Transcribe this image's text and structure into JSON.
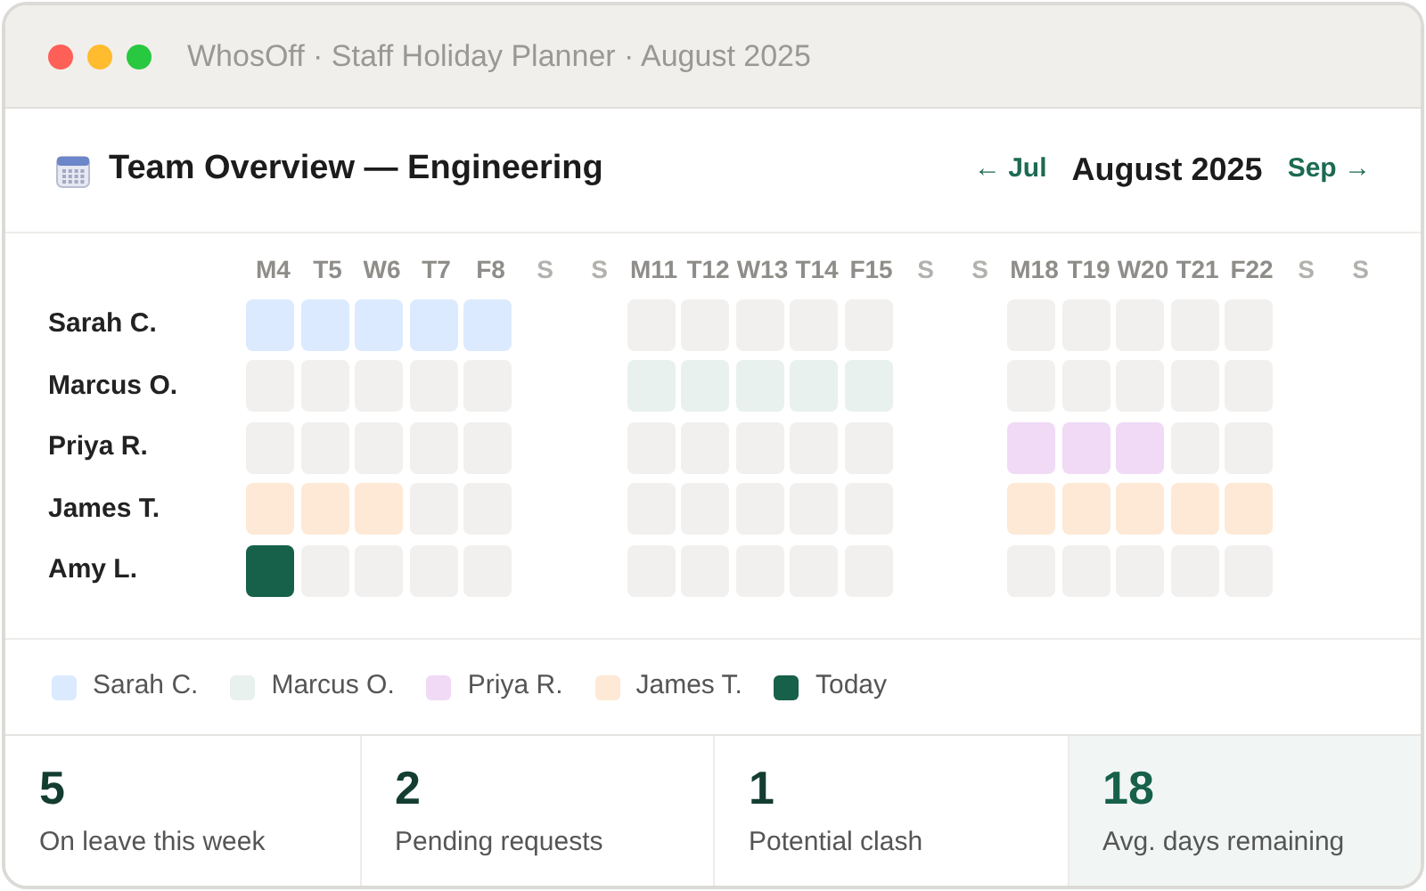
{
  "window": {
    "title": "WhosOff · Staff Holiday Planner · August 2025"
  },
  "header": {
    "title": "Team Overview — Engineering",
    "prev": "← Jul",
    "month": "August 2025",
    "next": "Sep →"
  },
  "days": [
    {
      "label": "M4",
      "weekend": false
    },
    {
      "label": "T5",
      "weekend": false
    },
    {
      "label": "W6",
      "weekend": false
    },
    {
      "label": "T7",
      "weekend": false
    },
    {
      "label": "F8",
      "weekend": false
    },
    {
      "label": "S",
      "weekend": true
    },
    {
      "label": "S",
      "weekend": true
    },
    {
      "label": "M11",
      "weekend": false
    },
    {
      "label": "T12",
      "weekend": false
    },
    {
      "label": "W13",
      "weekend": false
    },
    {
      "label": "T14",
      "weekend": false
    },
    {
      "label": "F15",
      "weekend": false
    },
    {
      "label": "S",
      "weekend": true
    },
    {
      "label": "S",
      "weekend": true
    },
    {
      "label": "M18",
      "weekend": false
    },
    {
      "label": "T19",
      "weekend": false
    },
    {
      "label": "W20",
      "weekend": false
    },
    {
      "label": "T21",
      "weekend": false
    },
    {
      "label": "F22",
      "weekend": false
    },
    {
      "label": "S",
      "weekend": true
    },
    {
      "label": "S",
      "weekend": true
    }
  ],
  "rows": [
    {
      "name": "Sarah C.",
      "cells": [
        {
          "kind": "leave"
        },
        {
          "kind": "leave"
        },
        {
          "kind": "leave"
        },
        {
          "kind": "leave"
        },
        {
          "kind": "leave"
        },
        {
          "kind": "free"
        },
        {
          "kind": "free"
        },
        {
          "kind": "free"
        },
        {
          "kind": "free"
        },
        {
          "kind": "free"
        },
        {
          "kind": "free"
        },
        {
          "kind": "free"
        },
        {
          "kind": "free"
        },
        {
          "kind": "free"
        },
        {
          "kind": "free"
        }
      ]
    },
    {
      "name": "Marcus O.",
      "cells": [
        {
          "kind": "free"
        },
        {
          "kind": "free"
        },
        {
          "kind": "free"
        },
        {
          "kind": "free"
        },
        {
          "kind": "free"
        },
        {
          "kind": "leave"
        },
        {
          "kind": "leave"
        },
        {
          "kind": "leave"
        },
        {
          "kind": "leave"
        },
        {
          "kind": "leave"
        },
        {
          "kind": "free"
        },
        {
          "kind": "free"
        },
        {
          "kind": "free"
        },
        {
          "kind": "free"
        },
        {
          "kind": "free"
        }
      ]
    },
    {
      "name": "Priya R.",
      "cells": [
        {
          "kind": "free"
        },
        {
          "kind": "free"
        },
        {
          "kind": "free"
        },
        {
          "kind": "free"
        },
        {
          "kind": "free"
        },
        {
          "kind": "free"
        },
        {
          "kind": "free"
        },
        {
          "kind": "free"
        },
        {
          "kind": "free"
        },
        {
          "kind": "free"
        },
        {
          "kind": "leave"
        },
        {
          "kind": "leave"
        },
        {
          "kind": "leave"
        },
        {
          "kind": "free"
        },
        {
          "kind": "free"
        }
      ]
    },
    {
      "name": "James T.",
      "cells": [
        {
          "kind": "leave"
        },
        {
          "kind": "leave"
        },
        {
          "kind": "leave"
        },
        {
          "kind": "free"
        },
        {
          "kind": "free"
        },
        {
          "kind": "free"
        },
        {
          "kind": "free"
        },
        {
          "kind": "free"
        },
        {
          "kind": "free"
        },
        {
          "kind": "free"
        },
        {
          "kind": "leave"
        },
        {
          "kind": "leave"
        },
        {
          "kind": "leave"
        },
        {
          "kind": "leave"
        },
        {
          "kind": "leave"
        }
      ]
    },
    {
      "name": "Amy L.",
      "cells": [
        {
          "kind": "today"
        },
        {
          "kind": "free"
        },
        {
          "kind": "free"
        },
        {
          "kind": "free"
        },
        {
          "kind": "free"
        },
        {
          "kind": "free"
        },
        {
          "kind": "free"
        },
        {
          "kind": "free"
        },
        {
          "kind": "free"
        },
        {
          "kind": "free"
        },
        {
          "kind": "free"
        },
        {
          "kind": "free"
        },
        {
          "kind": "free"
        },
        {
          "kind": "free"
        },
        {
          "kind": "free"
        }
      ]
    }
  ],
  "legend": [
    {
      "label": "Sarah C.",
      "color": "#dbeafe"
    },
    {
      "label": "Marcus O.",
      "color": "#e8f1ee"
    },
    {
      "label": "Priya R.",
      "color": "#f0daf6"
    },
    {
      "label": "James T.",
      "color": "#fde9d5"
    },
    {
      "label": "Today",
      "color": "#17604a"
    }
  ],
  "stats": [
    {
      "value": "5",
      "label": "On leave this week",
      "highlighted": false
    },
    {
      "value": "2",
      "label": "Pending requests",
      "highlighted": false
    },
    {
      "value": "1",
      "label": "Potential clash",
      "highlighted": false
    },
    {
      "value": "18",
      "label": "Avg. days remaining",
      "highlighted": true
    }
  ]
}
